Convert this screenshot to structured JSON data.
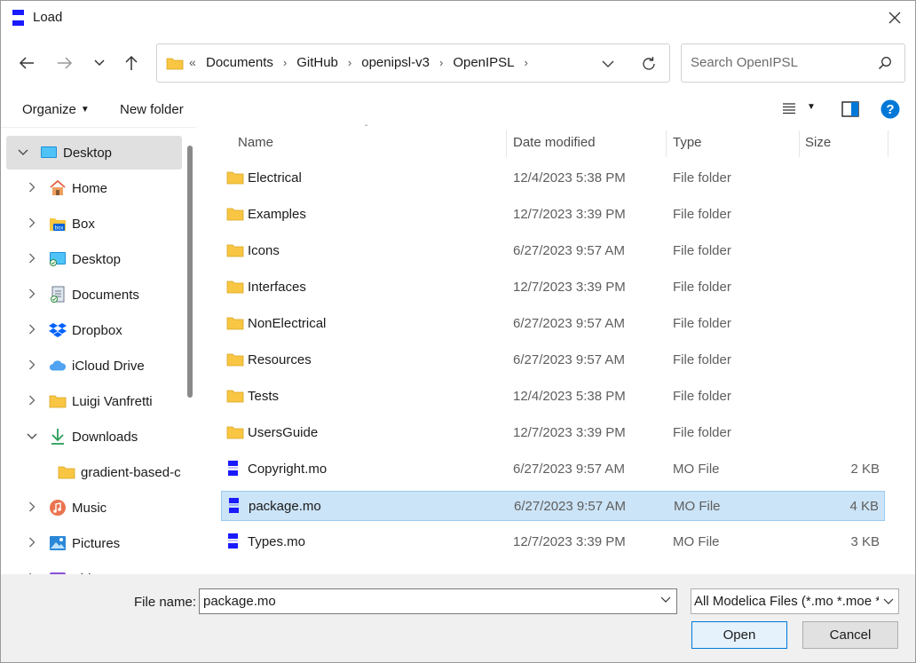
{
  "window": {
    "title": "Load"
  },
  "nav": {
    "breadcrumbs": [
      "Documents",
      "GitHub",
      "openipsl-v3",
      "OpenIPSL"
    ],
    "overflow_chevrons": "«",
    "search_placeholder": "Search OpenIPSL"
  },
  "commands": {
    "organize": "Organize",
    "new_folder": "New folder"
  },
  "sidebar": {
    "items": [
      {
        "label": "Desktop",
        "icon": "desktop-monitor-icon",
        "expander": "expanded"
      },
      {
        "label": "Home",
        "icon": "home-icon",
        "expander": "collapsed"
      },
      {
        "label": "Box",
        "icon": "box-icon",
        "expander": "collapsed"
      },
      {
        "label": "Desktop",
        "icon": "desktop-icon",
        "expander": "collapsed"
      },
      {
        "label": "Documents",
        "icon": "documents-icon",
        "expander": "collapsed"
      },
      {
        "label": "Dropbox",
        "icon": "dropbox-icon",
        "expander": "collapsed"
      },
      {
        "label": "iCloud Drive",
        "icon": "icloud-icon",
        "expander": "collapsed"
      },
      {
        "label": "Luigi Vanfretti",
        "icon": "folder-icon",
        "expander": "collapsed"
      },
      {
        "label": "Downloads",
        "icon": "downloads-icon",
        "expander": "expanded"
      },
      {
        "label": "gradient-based-c",
        "icon": "folder-icon",
        "expander": "none"
      },
      {
        "label": "Music",
        "icon": "music-icon",
        "expander": "collapsed"
      },
      {
        "label": "Pictures",
        "icon": "pictures-icon",
        "expander": "collapsed"
      },
      {
        "label": "Videos",
        "icon": "videos-icon",
        "expander": "collapsed"
      }
    ]
  },
  "columns": {
    "name": "Name",
    "date": "Date modified",
    "type": "Type",
    "size": "Size"
  },
  "files": [
    {
      "name": "Electrical",
      "date": "12/4/2023 5:38 PM",
      "type": "File folder",
      "size": "",
      "kind": "folder"
    },
    {
      "name": "Examples",
      "date": "12/7/2023 3:39 PM",
      "type": "File folder",
      "size": "",
      "kind": "folder"
    },
    {
      "name": "Icons",
      "date": "6/27/2023 9:57 AM",
      "type": "File folder",
      "size": "",
      "kind": "folder"
    },
    {
      "name": "Interfaces",
      "date": "12/7/2023 3:39 PM",
      "type": "File folder",
      "size": "",
      "kind": "folder"
    },
    {
      "name": "NonElectrical",
      "date": "6/27/2023 9:57 AM",
      "type": "File folder",
      "size": "",
      "kind": "folder"
    },
    {
      "name": "Resources",
      "date": "6/27/2023 9:57 AM",
      "type": "File folder",
      "size": "",
      "kind": "folder"
    },
    {
      "name": "Tests",
      "date": "12/4/2023 5:38 PM",
      "type": "File folder",
      "size": "",
      "kind": "folder"
    },
    {
      "name": "UsersGuide",
      "date": "12/7/2023 3:39 PM",
      "type": "File folder",
      "size": "",
      "kind": "folder"
    },
    {
      "name": "Copyright.mo",
      "date": "6/27/2023 9:57 AM",
      "type": "MO File",
      "size": "2 KB",
      "kind": "mo"
    },
    {
      "name": "package.mo",
      "date": "6/27/2023 9:57 AM",
      "type": "MO File",
      "size": "4 KB",
      "kind": "mo",
      "selected": true
    },
    {
      "name": "Types.mo",
      "date": "12/7/2023 3:39 PM",
      "type": "MO File",
      "size": "3 KB",
      "kind": "mo"
    }
  ],
  "bottom": {
    "file_name_label": "File name:",
    "file_name_value": "package.mo",
    "filter_value": "All Modelica Files (*.mo *.moe *",
    "open_label": "Open",
    "cancel_label": "Cancel"
  },
  "colors": {
    "accent": "#0078d7",
    "selection": "#cce4f7",
    "folder": "#f8c642",
    "mo_icon": "#1a1aff"
  }
}
